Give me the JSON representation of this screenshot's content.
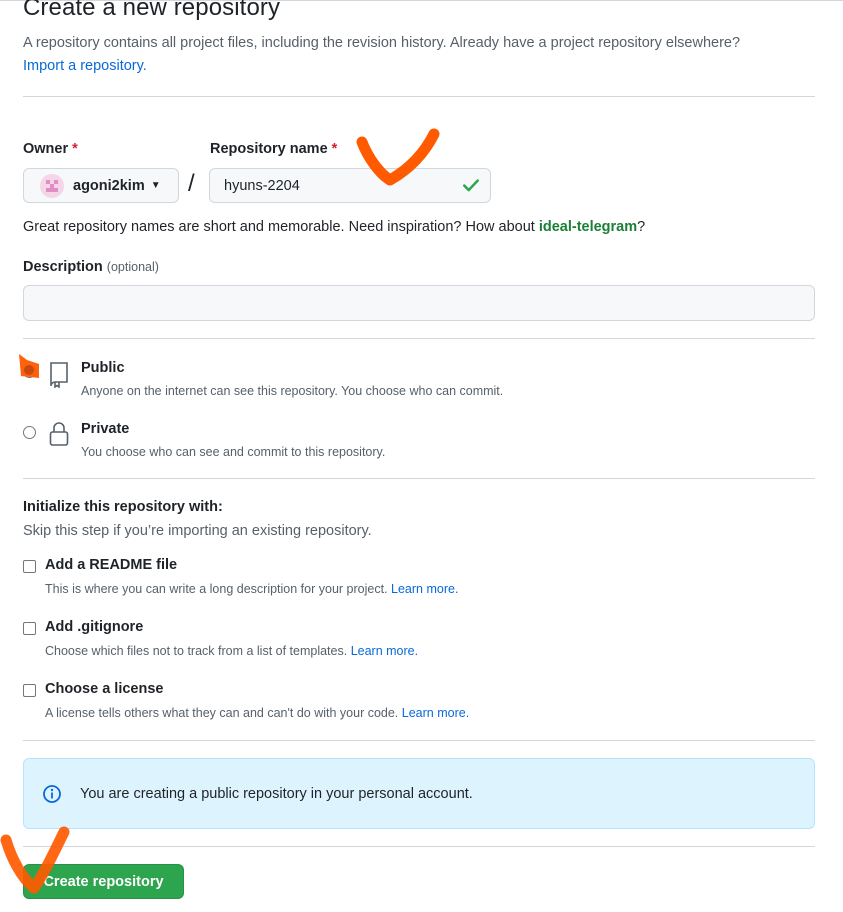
{
  "page": {
    "title": "Create a new repository",
    "subtitle": "A repository contains all project files, including the revision history. Already have a project repository elsewhere?",
    "import_link": "Import a repository."
  },
  "owner": {
    "label": "Owner",
    "required_mark": "*",
    "value": "agoni2kim"
  },
  "separator": "/",
  "repo_name": {
    "label": "Repository name",
    "required_mark": "*",
    "value": "hyuns-2204",
    "valid": true
  },
  "name_hint": {
    "text": "Great repository names are short and memorable. Need inspiration? How about ",
    "suggestion": "ideal-telegram",
    "end": "?"
  },
  "description": {
    "label": "Description",
    "optional": "(optional)",
    "value": ""
  },
  "visibility": {
    "selected": "public",
    "public": {
      "title": "Public",
      "desc": "Anyone on the internet can see this repository. You choose who can commit.",
      "icon": "repo-icon"
    },
    "private": {
      "title": "Private",
      "desc": "You choose who can see and commit to this repository.",
      "icon": "lock-icon"
    }
  },
  "initialize": {
    "title": "Initialize this repository with:",
    "subtitle": "Skip this step if you’re importing an existing repository.",
    "options": [
      {
        "title": "Add a README file",
        "desc": "This is where you can write a long description for your project.",
        "link": "Learn more.",
        "checked": false
      },
      {
        "title": "Add .gitignore",
        "desc": "Choose which files not to track from a list of templates.",
        "link": "Learn more.",
        "checked": false
      },
      {
        "title": "Choose a license",
        "desc": "A license tells others what they can and can't do with your code.",
        "link": "Learn more.",
        "checked": false
      }
    ]
  },
  "info": {
    "icon": "info-icon",
    "text": "You are creating a public repository in your personal account."
  },
  "submit": {
    "label": "Create repository"
  },
  "colors": {
    "accent_link": "#0969da",
    "success_green": "#2da44e",
    "annotation_orange": "#ff5a00",
    "info_bg": "#ddf4ff"
  }
}
